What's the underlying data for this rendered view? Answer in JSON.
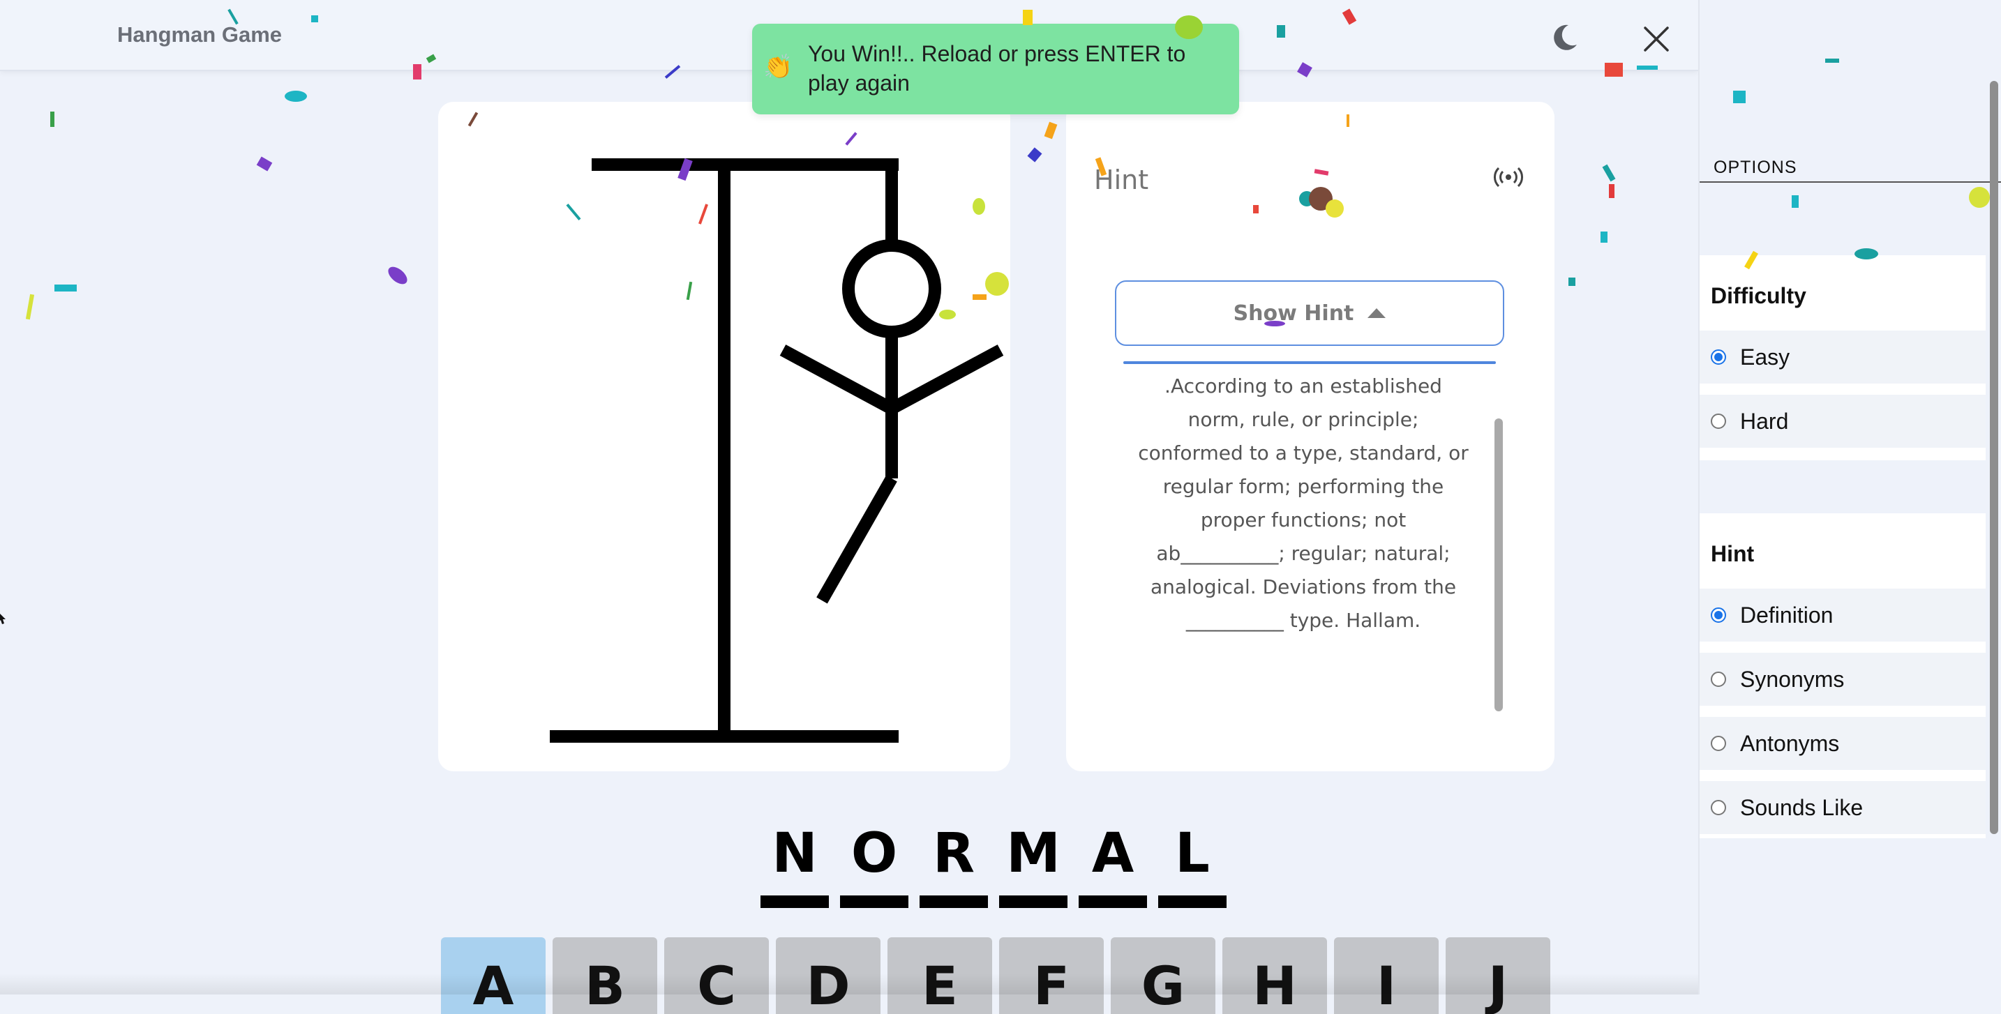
{
  "header": {
    "title": "Hangman Game"
  },
  "toast": {
    "emoji": "👏",
    "message": "You Win!!.. Reload or press ENTER to play again"
  },
  "hint_card": {
    "title": "Hint",
    "show_hint_label": "Show Hint",
    "text": ".According to an established norm, rule, or principle; conformed to a type, standard, or regular form; performing the proper functions; not ab__________; regular; natural; analogical. Deviations from the __________ type. Hallam."
  },
  "word": {
    "letters": [
      "N",
      "O",
      "R",
      "M",
      "A",
      "L"
    ]
  },
  "keyboard": {
    "keys": [
      "A",
      "B",
      "C",
      "D",
      "E",
      "F",
      "G",
      "H",
      "I",
      "J"
    ],
    "used": [
      "A"
    ]
  },
  "sidebar": {
    "options_label": "OPTIONS",
    "difficulty": {
      "title": "Difficulty",
      "options": [
        {
          "label": "Easy",
          "checked": true
        },
        {
          "label": "Hard",
          "checked": false
        }
      ]
    },
    "hint": {
      "title": "Hint",
      "options": [
        {
          "label": "Definition",
          "checked": true
        },
        {
          "label": "Synonyms",
          "checked": false
        },
        {
          "label": "Antonyms",
          "checked": false
        },
        {
          "label": "Sounds Like",
          "checked": false
        }
      ]
    }
  },
  "colors": {
    "toast_bg": "#7de3a1",
    "accent": "#1a73e8",
    "used_key": "#a9d1ef",
    "key_bg": "#c3c5c9"
  },
  "icons": [
    "moon-icon",
    "close-icon",
    "speaker-icon",
    "caret-up-icon",
    "clap-emoji"
  ]
}
